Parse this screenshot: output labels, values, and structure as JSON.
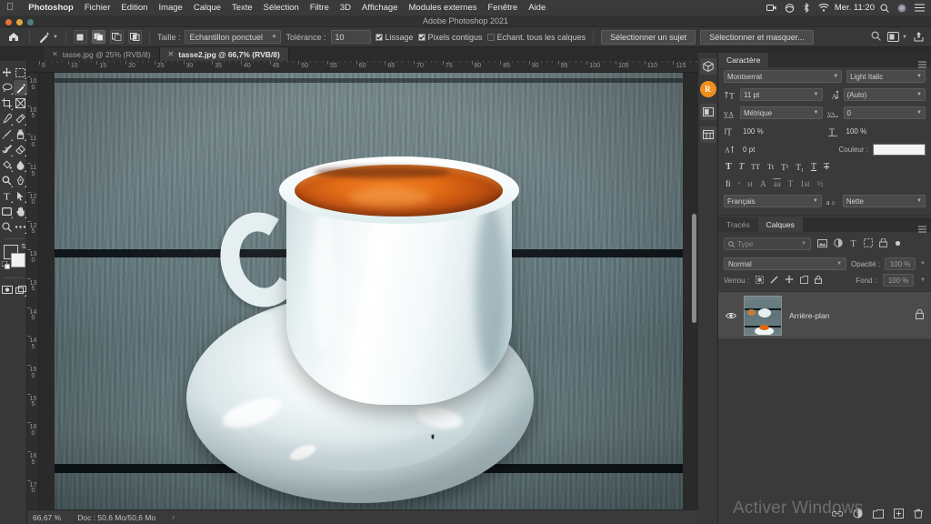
{
  "macbar": {
    "apple_icon": "apple-icon",
    "items": [
      {
        "label": "Photoshop",
        "bold": true
      },
      {
        "label": "Fichier",
        "bold": false
      },
      {
        "label": "Edition",
        "bold": false
      },
      {
        "label": "Image",
        "bold": false
      },
      {
        "label": "Calque",
        "bold": false
      },
      {
        "label": "Texte",
        "bold": false
      },
      {
        "label": "Sélection",
        "bold": false
      },
      {
        "label": "Filtre",
        "bold": false
      },
      {
        "label": "3D",
        "bold": false
      },
      {
        "label": "Affichage",
        "bold": false
      },
      {
        "label": "Modules externes",
        "bold": false
      },
      {
        "label": "Fenêtre",
        "bold": false
      },
      {
        "label": "Aide",
        "bold": false
      }
    ],
    "tray_icons": [
      "screen-record-icon",
      "display-mirror-icon",
      "bluetooth-icon",
      "wifi-icon"
    ],
    "clock": "Mer. 11:20",
    "right_icons": [
      "search-icon",
      "siri-icon",
      "control-center-icon"
    ]
  },
  "titlebar": {
    "title": "Adobe Photoshop 2021",
    "close_label": "close",
    "minimize_label": "minimize",
    "zoom_label": "zoom"
  },
  "optionsbar": {
    "home_icon": "home-icon",
    "tool_icon": "magic-wand-icon",
    "selection_modes": [
      "new-selection",
      "add-to-selection",
      "subtract-from-selection",
      "intersect-selection"
    ],
    "active_selection_mode": 1,
    "size_label": "Taille :",
    "size_value": "Echantillon ponctuel",
    "tolerance_label": "Tolérance :",
    "tolerance_value": "10",
    "checkbox_smoothing": {
      "label": "Lissage",
      "checked": true
    },
    "checkbox_contiguous": {
      "label": "Pixels contigus",
      "checked": true
    },
    "checkbox_all_layers": {
      "label": "Echant. tous les calques",
      "checked": false
    },
    "button_select_subject": "Sélectionner un sujet",
    "button_select_and_mask": "Sélectionner et masquer...",
    "right_icons": [
      "search-icon",
      "workspace-icon",
      "chevron-down-icon",
      "share-icon"
    ]
  },
  "tabs": [
    {
      "label": "tasse.jpg @ 25% (RVB/8)",
      "active": false
    },
    {
      "label": "tasse2.jpg @ 66,7% (RVB/8)",
      "active": true
    }
  ],
  "toolbar": {
    "tools": [
      {
        "name": "move-tool",
        "glyph": "move"
      },
      {
        "name": "marquee-tool",
        "glyph": "marquee"
      },
      {
        "name": "lasso-tool",
        "glyph": "lasso"
      },
      {
        "name": "magic-wand-tool",
        "glyph": "wand",
        "selected": true
      },
      {
        "name": "crop-tool",
        "glyph": "crop"
      },
      {
        "name": "frame-tool",
        "glyph": "frame"
      },
      {
        "name": "eyedropper-tool",
        "glyph": "eyedropper"
      },
      {
        "name": "healing-brush-tool",
        "glyph": "healing"
      },
      {
        "name": "brush-tool",
        "glyph": "brush"
      },
      {
        "name": "clone-stamp-tool",
        "glyph": "stamp"
      },
      {
        "name": "history-brush-tool",
        "glyph": "historybrush"
      },
      {
        "name": "eraser-tool",
        "glyph": "eraser"
      },
      {
        "name": "gradient-tool",
        "glyph": "bucket"
      },
      {
        "name": "blur-tool",
        "glyph": "blur"
      },
      {
        "name": "dodge-tool",
        "glyph": "dodge"
      },
      {
        "name": "pen-tool",
        "glyph": "pen"
      },
      {
        "name": "type-tool",
        "glyph": "type"
      },
      {
        "name": "path-selection-tool",
        "glyph": "arrow"
      },
      {
        "name": "rectangle-tool",
        "glyph": "rect"
      },
      {
        "name": "hand-tool",
        "glyph": "hand"
      },
      {
        "name": "zoom-tool",
        "glyph": "zoom"
      },
      {
        "name": "edit-toolbar-tool",
        "glyph": "dots"
      }
    ],
    "foreground_color": "#3b3b3b",
    "background_color": "#f2f2f2",
    "swap_icon": "swap-colors-icon",
    "default_icon": "default-colors-icon",
    "quickmask_icon": "quick-mask-icon",
    "screenmode_icon": "screen-mode-icon"
  },
  "rulers": {
    "unit": "mm",
    "horizontal_labels": [
      "5",
      "10",
      "15",
      "20",
      "25",
      "30",
      "35",
      "40",
      "45",
      "50",
      "55",
      "60",
      "65",
      "70",
      "75",
      "80",
      "85",
      "90",
      "95",
      "100",
      "105",
      "110",
      "115"
    ],
    "vertical_labels": [
      "100",
      "105",
      "110",
      "115",
      "120",
      "125",
      "130",
      "135",
      "140",
      "145",
      "150",
      "155",
      "160",
      "165",
      "170",
      "175"
    ]
  },
  "statusbar": {
    "zoom": "66,67 %",
    "doc_info": "Doc : 50,6 Mo/50,6 Mo",
    "arrow": "›"
  },
  "rail": {
    "buttons": [
      {
        "name": "3d-panel-icon",
        "glyph": "cube"
      },
      {
        "name": "user-avatar-icon",
        "glyph": "R"
      },
      {
        "name": "properties-panel-icon",
        "glyph": "panel"
      },
      {
        "name": "libraries-panel-icon",
        "glyph": "grid"
      }
    ]
  },
  "character_panel": {
    "tab_label": "Caractère",
    "menu_icon": "panel-menu-icon",
    "font_family": "Montserrat",
    "font_style": "Light Italic",
    "font_size_icon": "font-size-icon",
    "font_size": "11 pt",
    "leading_icon": "leading-icon",
    "leading": "(Auto)",
    "kerning_icon": "kerning-icon",
    "kerning": "Métrique",
    "tracking_icon": "tracking-icon",
    "tracking": "0",
    "vertical_scale_icon": "vertical-scale-icon",
    "vertical_scale": "100 %",
    "horizontal_scale_icon": "horizontal-scale-icon",
    "horizontal_scale": "100 %",
    "baseline_icon": "baseline-shift-icon",
    "baseline_shift": "0 pt",
    "color_label": "Couleur :",
    "color_value": "#f4f4f4",
    "style_row1": [
      "T",
      "T",
      "TT",
      "Tt",
      "T¹",
      "T₁",
      "T",
      "T"
    ],
    "style_row2": [
      "fi",
      "ᵒ",
      "st",
      "A",
      "aa",
      "T",
      "1st",
      "½"
    ],
    "language": "Français",
    "antialias_icon": "anti-alias-icon",
    "antialias": "Nette"
  },
  "layers_panel": {
    "tabs": [
      {
        "label": "Tracés",
        "active": false
      },
      {
        "label": "Calques",
        "active": true
      }
    ],
    "menu_icon": "panel-menu-icon",
    "filter_icon": "search-icon",
    "filter_placeholder": "Type",
    "filter_icons": [
      "image-filter-icon",
      "adjustment-filter-icon",
      "type-filter-icon",
      "shape-filter-icon",
      "smartobject-filter-icon"
    ],
    "filter_toggle_icon": "filter-toggle-icon",
    "blend_mode": "Normal",
    "opacity_label": "Opacité :",
    "opacity_value": "100 %",
    "lock_label": "Verrou :",
    "lock_icons": [
      "lock-transparency-icon",
      "lock-image-icon",
      "lock-position-icon",
      "lock-artboard-icon",
      "lock-all-icon"
    ],
    "fill_label": "Fond :",
    "fill_value": "100 %",
    "layers": [
      {
        "name": "Arrière-plan",
        "visible": true,
        "locked": true,
        "visibility_icon": "eye-icon",
        "lock_icon": "lock-icon",
        "thumbnail_name": "layer-thumbnail"
      }
    ],
    "footer_icons": [
      "link-layers-icon",
      "layer-style-icon",
      "new-group-icon",
      "new-layer-icon",
      "delete-layer-icon"
    ]
  },
  "watermark": {
    "text": "Activer Windows"
  },
  "canvas": {
    "document_name": "tasse2.jpg",
    "image_description": "espresso-cup-photo"
  }
}
